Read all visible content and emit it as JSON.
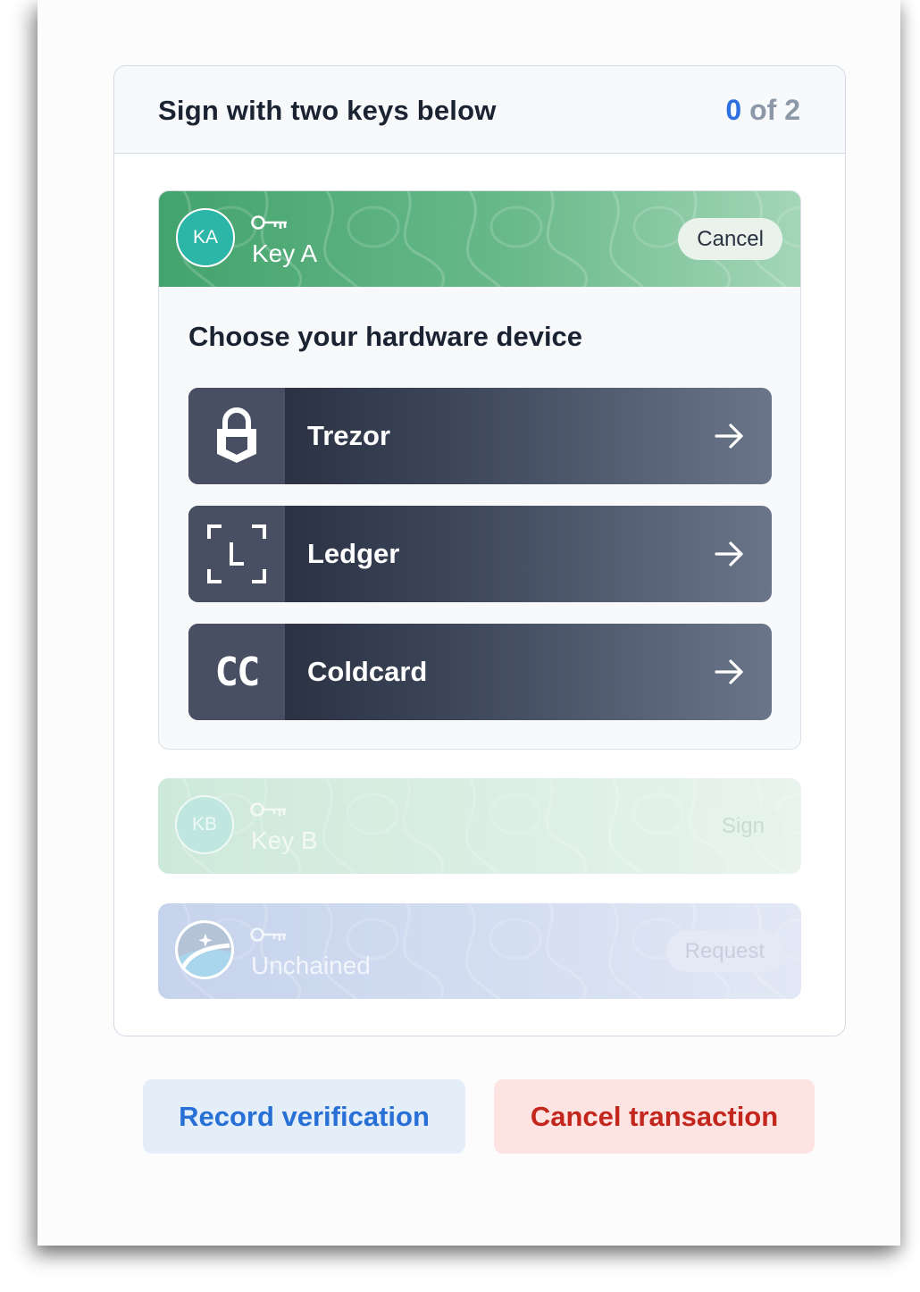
{
  "header": {
    "title": "Sign with two keys below",
    "progress_count": "0",
    "progress_rest": " of 2"
  },
  "keys": [
    {
      "initials": "KA",
      "name": "Key A",
      "action": "Cancel",
      "state": "active",
      "choose_title": "Choose your hardware device",
      "devices": [
        {
          "name": "Trezor",
          "icon": "trezor-icon"
        },
        {
          "name": "Ledger",
          "icon": "ledger-icon"
        },
        {
          "name": "Coldcard",
          "icon": "coldcard-icon",
          "icon_text": "CC"
        }
      ]
    },
    {
      "initials": "KB",
      "name": "Key B",
      "action": "Sign",
      "state": "disabled"
    },
    {
      "initials": "",
      "name": "Unchained",
      "action": "Request",
      "state": "disabled"
    }
  ],
  "footer": {
    "record_label": "Record verification",
    "cancel_label": "Cancel transaction"
  },
  "colors": {
    "accent_blue": "#2f6fe0",
    "key_green": "#43a36d",
    "danger_red": "#c2261d",
    "device_dark": "#1f2637"
  }
}
